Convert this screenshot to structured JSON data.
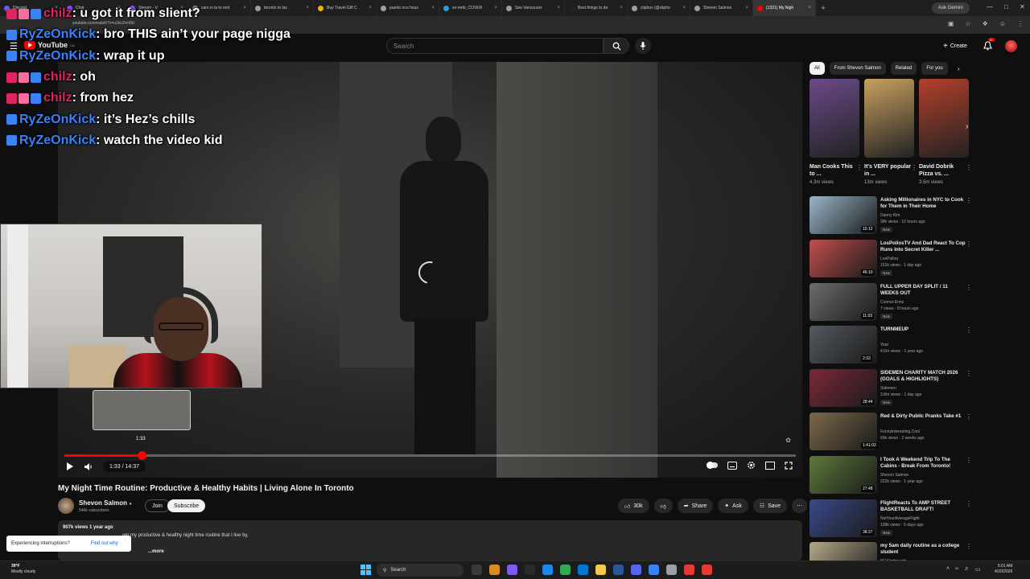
{
  "browser": {
    "tabs": [
      {
        "label": "Discord",
        "fav": "#5865f2"
      },
      {
        "label": "Chat",
        "fav": "#9146ff"
      },
      {
        "label": "Stream - V",
        "fav": "#9146ff"
      },
      {
        "label": "cars in la to rent",
        "fav": "#9aa0a6"
      },
      {
        "label": "toronto to las",
        "fav": "#9aa0a6"
      },
      {
        "label": "Buy Travel Gift C",
        "fav": "#f0b400"
      },
      {
        "label": "puerto rico hous",
        "fav": "#9aa0a6"
      },
      {
        "label": "sir-mrkt_COVER",
        "fav": "#1ba1e2"
      },
      {
        "label": "See Vancouver",
        "fav": "#9aa0a6"
      },
      {
        "label": "Best things to do",
        "fav": "#222"
      },
      {
        "label": "cliphox (@clipho",
        "fav": "#9aa0a6"
      },
      {
        "label": "Shevon Salmon",
        "fav": "#9aa0a6"
      },
      {
        "label": "(1321) My Nigh",
        "fav": "#ff0000"
      }
    ],
    "ask_gemini": "Ask Gemini",
    "url": "youtube.com/watch?v=u1kcZrrn0U"
  },
  "chat": [
    {
      "user": "chilz",
      "user_color": "#e0245e",
      "badges": [
        "#e0245e",
        "#ff6ba0",
        "#3b82f6"
      ],
      "msg": ": u got it from slient?"
    },
    {
      "user": "RyZeOnKick",
      "user_color": "#3b82f6",
      "badges": [
        "#3b82f6"
      ],
      "msg": ": bro THIS ain’t your page nigga"
    },
    {
      "user": "RyZeOnKick",
      "user_color": "#3b82f6",
      "badges": [
        "#3b82f6"
      ],
      "msg": ": wrap it up"
    },
    {
      "user": "chilz",
      "user_color": "#e0245e",
      "badges": [
        "#e0245e",
        "#ff6ba0",
        "#3b82f6"
      ],
      "msg": ": oh"
    },
    {
      "user": "chilz",
      "user_color": "#e0245e",
      "badges": [
        "#e0245e",
        "#ff6ba0",
        "#3b82f6"
      ],
      "msg": ": from hez"
    },
    {
      "user": "RyZeOnKick",
      "user_color": "#3b82f6",
      "badges": [
        "#3b82f6"
      ],
      "msg": ": it’s Hez’s chills"
    },
    {
      "user": "RyZeOnKick",
      "user_color": "#3b82f6",
      "badges": [
        "#3b82f6"
      ],
      "msg": ": watch the video kid"
    }
  ],
  "header": {
    "logo": "YouTube",
    "logo_region": "CA",
    "search_placeholder": "Search",
    "create_label": "Create",
    "notif_count": "9+"
  },
  "player": {
    "scrub_time": "1:33",
    "time_display": "1:33 / 14:37",
    "progress": 0.106
  },
  "video": {
    "title": "My Night Time Routine: Productive & Healthy Habits | Living Alone In Toronto",
    "channel": "Shevon Salmon",
    "verified": "●",
    "subs": "546k subscribers",
    "join": "Join",
    "subscribe": "Subscribe",
    "likes": "30k",
    "share": "Share",
    "ask": "Ask",
    "save": "Save",
    "meta": "907k views  1 year ago",
    "desc": "ver my productive & healthy night time routine that I live by,",
    "more": "...more",
    "interrupt_text": "Experiencing interruptions?",
    "interrupt_link": "Find out why"
  },
  "sidebar": {
    "chips": [
      "All",
      "From Shevon Salmon",
      "Related",
      "For you"
    ],
    "shorts": [
      {
        "title": "Man Cooks This to ...",
        "views": "4.3m views",
        "color": "#6b4a8a"
      },
      {
        "title": "It's VERY popular in ...",
        "views": "13m views",
        "color": "#c9a060"
      },
      {
        "title": "David Dobrik Pizza vs. ...",
        "views": "3.5m views",
        "color": "#b3402a"
      }
    ],
    "recs": [
      {
        "title": "Asking Millionaires in NYC to Cook for Them in Their Home",
        "channel": "Danny Kim",
        "meta": "38k views · 12 hours ago",
        "new": "New",
        "dur": "15:12",
        "color": "#9ab7c9"
      },
      {
        "title": "LosPollosTV And Dad React To Cop Runs Into Secret Killer ...",
        "channel": "LosPolloq",
        "meta": "151k views · 1 day ago",
        "new": "New",
        "dur": "46:10",
        "color": "#c0504d"
      },
      {
        "title": "FULL UPPER DAY SPLIT / 11 WEEKS OUT",
        "channel": "Connor Enns",
        "meta": "7 views · 8 hours ago",
        "new": "New",
        "dur": "11:03",
        "color": "#6d6d6d"
      },
      {
        "title": "TURNMEUP",
        "channel": "Yeat",
        "meta": "4.6m views · 1 year ago",
        "new": "",
        "dur": "2:33",
        "color": "#555a60"
      },
      {
        "title": "SIDEMEN CHARITY MATCH 2026 (GOALS & HIGHLIGHTS)",
        "channel": "Sidemen",
        "meta": "3.8m views · 1 day ago",
        "new": "New",
        "dur": "28:44",
        "color": "#7a2a3a"
      },
      {
        "title": "Red & Dirty Public Pranks Take #1",
        "channel": "FunnyInteresting.Cool",
        "meta": "60k views · 2 weeks ago",
        "new": "",
        "dur": "1:41:03",
        "color": "#7c6a4a"
      },
      {
        "title": "I Took A Weekend Trip To The Cabins - Break From Toronto!",
        "channel": "Shevon Salmon",
        "meta": "222k views · 1 year ago",
        "new": "",
        "dur": "27:48",
        "color": "#5e7a3a"
      },
      {
        "title": "FlightReacts To AMP STREET BASKETBALL DRAFT!",
        "channel": "NotYourAverageFlight",
        "meta": "138k views · 5 days ago",
        "new": "New",
        "dur": "38:27",
        "color": "#3a4a8a"
      },
      {
        "title": "my 5am daily routine as a college student",
        "channel": "MJ Kimbrough",
        "meta": "",
        "new": "",
        "dur": "",
        "color": "#b5a98a"
      }
    ]
  },
  "taskbar": {
    "temp": "39°F",
    "weather": "Mostly cloudy",
    "search": "Search",
    "time": "5:01 AM",
    "date": "4/20/2026",
    "apps": [
      "#3a3a3a",
      "#d98c1f",
      "#7f5af0",
      "#2a2a2a",
      "#1e88e5",
      "#34a853",
      "#0078d4",
      "#f2c94c",
      "#2b5797",
      "#5865f2",
      "#3b82f6",
      "#9aa0a6",
      "#e53935",
      "#e53935"
    ]
  }
}
